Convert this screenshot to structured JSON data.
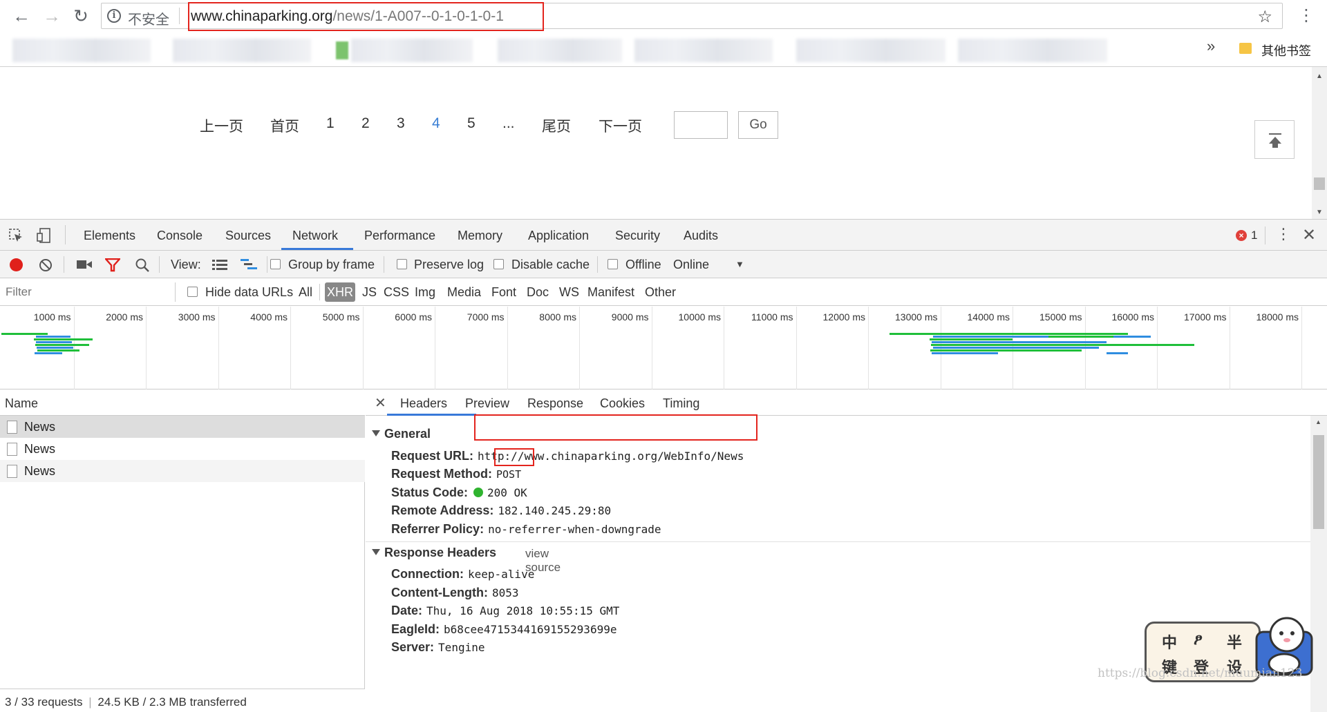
{
  "browser": {
    "security_label": "不安全",
    "url_host": "www.chinaparking.org",
    "url_path": "/news/1-A007--0-1-0-1-0-1",
    "bookmarks_more": "»",
    "other_bookmarks": "其他书签"
  },
  "pagination": {
    "prev": "上一页",
    "first": "首页",
    "pages": [
      "1",
      "2",
      "3",
      "4",
      "5"
    ],
    "current_page": "4",
    "ellipsis": "...",
    "last": "尾页",
    "next": "下一页",
    "go_label": "Go"
  },
  "devtools": {
    "tabs": [
      "Elements",
      "Console",
      "Sources",
      "Network",
      "Performance",
      "Memory",
      "Application",
      "Security",
      "Audits"
    ],
    "active_tab": "Network",
    "error_count": "1",
    "toolbar": {
      "view_label": "View:",
      "group_by_frame": "Group by frame",
      "preserve_log": "Preserve log",
      "disable_cache": "Disable cache",
      "offline": "Offline",
      "throttle": "Online"
    },
    "filter": {
      "placeholder": "Filter",
      "hide_data_urls": "Hide data URLs",
      "types": [
        "All",
        "XHR",
        "JS",
        "CSS",
        "Img",
        "Media",
        "Font",
        "Doc",
        "WS",
        "Manifest",
        "Other"
      ],
      "active_type": "XHR"
    },
    "timeline": {
      "tick_labels": [
        "1000 ms",
        "2000 ms",
        "3000 ms",
        "4000 ms",
        "5000 ms",
        "6000 ms",
        "7000 ms",
        "8000 ms",
        "9000 ms",
        "10000 ms",
        "11000 ms",
        "12000 ms",
        "13000 ms",
        "14000 ms",
        "15000 ms",
        "16000 ms",
        "17000 ms",
        "18000 ms"
      ],
      "colors": {
        "waiting": "#1fbf3a",
        "download": "#2f8de0"
      }
    },
    "requests": {
      "column_name": "Name",
      "rows": [
        "News",
        "News",
        "News"
      ],
      "status": "3 / 33 requests",
      "transfer": "24.5 KB / 2.3 MB transferred"
    },
    "detail": {
      "tabs": [
        "Headers",
        "Preview",
        "Response",
        "Cookies",
        "Timing"
      ],
      "active_tab": "Headers",
      "general_title": "General",
      "general": [
        {
          "key": "Request URL:",
          "value": "http://www.chinaparking.org/WebInfo/News"
        },
        {
          "key": "Request Method:",
          "value": "POST"
        },
        {
          "key": "Status Code:",
          "value": "200 OK"
        },
        {
          "key": "Remote Address:",
          "value": "182.140.245.29:80"
        },
        {
          "key": "Referrer Policy:",
          "value": "no-referrer-when-downgrade"
        }
      ],
      "response_title": "Response Headers",
      "view_source": "view source",
      "response": [
        {
          "key": "Connection:",
          "value": "keep-alive"
        },
        {
          "key": "Content-Length:",
          "value": "8053"
        },
        {
          "key": "Date:",
          "value": "Thu, 16 Aug 2018 10:55:15 GMT"
        },
        {
          "key": "EagleId:",
          "value": "b68cee4715344169155293699e"
        },
        {
          "key": "Server:",
          "value": "Tengine"
        }
      ]
    }
  },
  "watermark": "https://blog.csdn.net/muumian123",
  "logo_chars": [
    "中",
    "ፆ",
    "半",
    "键",
    "登",
    "设"
  ],
  "accent_colors": {
    "highlight_box": "#e3241d",
    "active_blue": "#3879d9",
    "record_red": "#e0201b",
    "status_green": "#2fb32f"
  }
}
